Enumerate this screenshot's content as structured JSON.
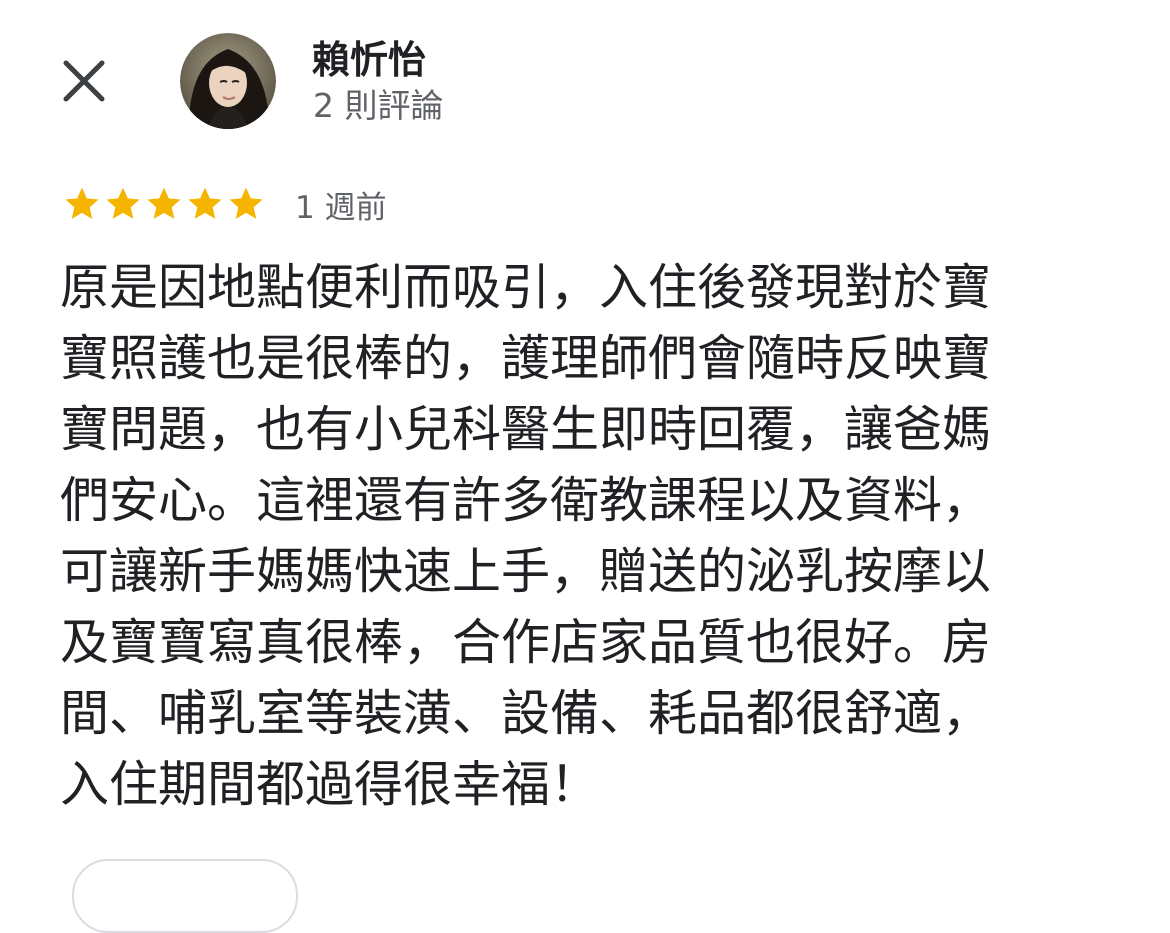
{
  "header": {
    "close_icon": "close-icon",
    "reviewer_name": "賴忻怡",
    "review_count": "2 則評論",
    "avatar_icon": "avatar"
  },
  "review": {
    "rating": 5,
    "rating_max": 5,
    "star_color": "#F4B400",
    "time": "1 週前",
    "lines": [
      "原是因地點便利而吸引，入住後發現對於寶",
      "寶照護也是很棒的，護理師們會隨時反映寶",
      "寶問題，也有小兒科醫生即時回覆，讓爸媽",
      "們安心。這裡還有許多衛教課程以及資料，",
      "可讓新手媽媽快速上手，贈送的泌乳按摩以",
      "及寶寶寫真很棒，合作店家品質也很好。房",
      "間、哺乳室等裝潢、設備、耗品都很舒適，",
      "入住期間都過得很幸福！"
    ]
  }
}
